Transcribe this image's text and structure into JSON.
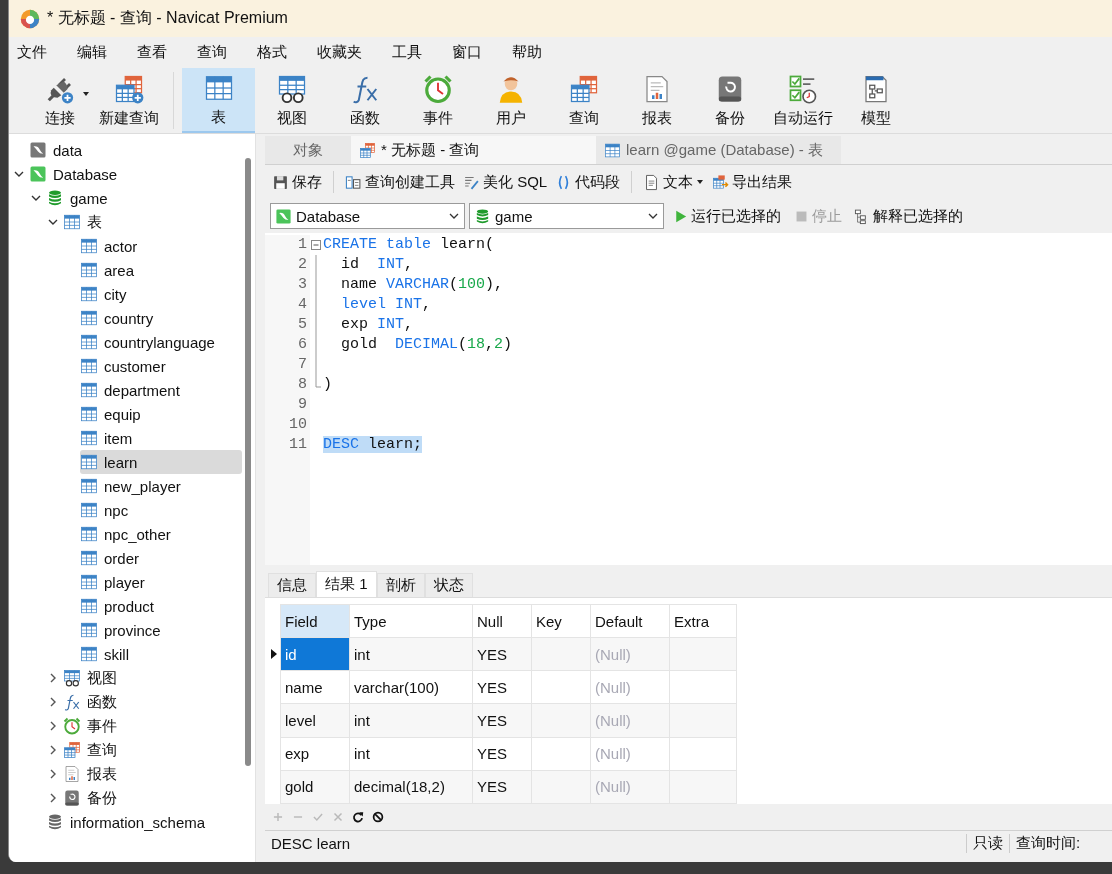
{
  "window": {
    "title": "* 无标题 - 查询 - Navicat Premium"
  },
  "menu": [
    "文件",
    "编辑",
    "查看",
    "查询",
    "格式",
    "收藏夹",
    "工具",
    "窗口",
    "帮助"
  ],
  "toolbar": [
    {
      "label": "连接",
      "selected": false,
      "dropdown": true
    },
    {
      "label": "新建查询",
      "selected": false,
      "dropdown": false
    },
    {
      "label": "表",
      "selected": true,
      "dropdown": false
    },
    {
      "label": "视图",
      "selected": false,
      "dropdown": false
    },
    {
      "label": "函数",
      "selected": false,
      "dropdown": false
    },
    {
      "label": "事件",
      "selected": false,
      "dropdown": false
    },
    {
      "label": "用户",
      "selected": false,
      "dropdown": false
    },
    {
      "label": "查询",
      "selected": false,
      "dropdown": false
    },
    {
      "label": "报表",
      "selected": false,
      "dropdown": false
    },
    {
      "label": "备份",
      "selected": false,
      "dropdown": false
    },
    {
      "label": "自动运行",
      "selected": false,
      "dropdown": false
    },
    {
      "label": "模型",
      "selected": false,
      "dropdown": false
    }
  ],
  "tree": [
    {
      "label": "data",
      "kind": "connection",
      "connected": false,
      "selected": false
    },
    {
      "label": "Database",
      "kind": "connection",
      "connected": true,
      "selected": false,
      "expanded": true,
      "children": [
        {
          "label": "game",
          "kind": "database",
          "connected": true,
          "selected": false,
          "expanded": true,
          "children": [
            {
              "label": "表",
              "kind": "tables",
              "selected": false,
              "expanded": true,
              "children": [
                {
                  "label": "actor",
                  "kind": "table",
                  "selected": false
                },
                {
                  "label": "area",
                  "kind": "table",
                  "selected": false
                },
                {
                  "label": "city",
                  "kind": "table",
                  "selected": false
                },
                {
                  "label": "country",
                  "kind": "table",
                  "selected": false
                },
                {
                  "label": "countrylanguage",
                  "kind": "table",
                  "selected": false
                },
                {
                  "label": "customer",
                  "kind": "table",
                  "selected": false
                },
                {
                  "label": "department",
                  "kind": "table",
                  "selected": false
                },
                {
                  "label": "equip",
                  "kind": "table",
                  "selected": false
                },
                {
                  "label": "item",
                  "kind": "table",
                  "selected": false
                },
                {
                  "label": "learn",
                  "kind": "table",
                  "selected": true
                },
                {
                  "label": "new_player",
                  "kind": "table",
                  "selected": false
                },
                {
                  "label": "npc",
                  "kind": "table",
                  "selected": false
                },
                {
                  "label": "npc_other",
                  "kind": "table",
                  "selected": false
                },
                {
                  "label": "order",
                  "kind": "table",
                  "selected": false
                },
                {
                  "label": "player",
                  "kind": "table",
                  "selected": false
                },
                {
                  "label": "product",
                  "kind": "table",
                  "selected": false
                },
                {
                  "label": "province",
                  "kind": "table",
                  "selected": false
                },
                {
                  "label": "skill",
                  "kind": "table",
                  "selected": false
                }
              ]
            },
            {
              "label": "视图",
              "kind": "views",
              "selected": false,
              "expanded": false
            },
            {
              "label": "函数",
              "kind": "functions",
              "selected": false,
              "expanded": false
            },
            {
              "label": "事件",
              "kind": "events",
              "selected": false,
              "expanded": false
            },
            {
              "label": "查询",
              "kind": "queries",
              "selected": false,
              "expanded": false
            },
            {
              "label": "报表",
              "kind": "reports",
              "selected": false,
              "expanded": false
            },
            {
              "label": "备份",
              "kind": "backups",
              "selected": false,
              "expanded": false
            }
          ]
        },
        {
          "label": "information_schema",
          "kind": "database",
          "connected": false,
          "selected": false
        }
      ]
    }
  ],
  "doc_tabs": [
    {
      "label": "对象",
      "kind": "objects",
      "selected": false
    },
    {
      "label": "* 无标题 - 查询",
      "kind": "query",
      "selected": true
    },
    {
      "label": "learn @game (Database) - 表",
      "kind": "table",
      "selected": false
    }
  ],
  "query_toolbar": [
    {
      "label": "保存",
      "dropdown": false
    },
    {
      "label": "查询创建工具",
      "dropdown": false
    },
    {
      "label": "美化 SQL",
      "dropdown": false
    },
    {
      "label": "代码段",
      "dropdown": false
    },
    {
      "label": "文本",
      "dropdown": true
    },
    {
      "label": "导出结果",
      "dropdown": false
    }
  ],
  "connection_select": {
    "value": "Database"
  },
  "database_select": {
    "value": "game"
  },
  "run_actions": [
    {
      "label": "运行已选择的",
      "disabled": false
    },
    {
      "label": "停止",
      "disabled": true
    },
    {
      "label": "解释已选择的",
      "disabled": false
    }
  ],
  "editor": {
    "lines": [
      {
        "number": "1",
        "fold_start": true,
        "in_fold": false,
        "fold_end": false,
        "selected": false,
        "tokens": [
          {
            "text": "CREATE table ",
            "kind": "keyword"
          },
          {
            "text": "learn(",
            "kind": "plain"
          }
        ]
      },
      {
        "number": "2",
        "fold_start": false,
        "in_fold": true,
        "fold_end": false,
        "selected": false,
        "tokens": [
          {
            "text": "  id  ",
            "kind": "plain"
          },
          {
            "text": "INT",
            "kind": "keyword"
          },
          {
            "text": ",",
            "kind": "plain"
          }
        ]
      },
      {
        "number": "3",
        "fold_start": false,
        "in_fold": true,
        "fold_end": false,
        "selected": false,
        "tokens": [
          {
            "text": "  name ",
            "kind": "plain"
          },
          {
            "text": "VARCHAR",
            "kind": "keyword"
          },
          {
            "text": "(",
            "kind": "plain"
          },
          {
            "text": "100",
            "kind": "number"
          },
          {
            "text": "),",
            "kind": "plain"
          }
        ]
      },
      {
        "number": "4",
        "fold_start": false,
        "in_fold": true,
        "fold_end": false,
        "selected": false,
        "tokens": [
          {
            "text": "  level INT",
            "kind": "keyword"
          },
          {
            "text": ",",
            "kind": "plain"
          }
        ]
      },
      {
        "number": "5",
        "fold_start": false,
        "in_fold": true,
        "fold_end": false,
        "selected": false,
        "tokens": [
          {
            "text": "  exp ",
            "kind": "plain"
          },
          {
            "text": "INT",
            "kind": "keyword"
          },
          {
            "text": ",",
            "kind": "plain"
          }
        ]
      },
      {
        "number": "6",
        "fold_start": false,
        "in_fold": true,
        "fold_end": false,
        "selected": false,
        "tokens": [
          {
            "text": "  gold  ",
            "kind": "plain"
          },
          {
            "text": "DECIMAL",
            "kind": "keyword"
          },
          {
            "text": "(",
            "kind": "plain"
          },
          {
            "text": "18",
            "kind": "number"
          },
          {
            "text": ",",
            "kind": "plain"
          },
          {
            "text": "2",
            "kind": "number"
          },
          {
            "text": ")",
            "kind": "plain"
          }
        ]
      },
      {
        "number": "7",
        "fold_start": false,
        "in_fold": true,
        "fold_end": false,
        "selected": false
      },
      {
        "number": "8",
        "fold_start": false,
        "in_fold": false,
        "fold_end": true,
        "selected": false,
        "tokens": [
          {
            "text": ")",
            "kind": "plain"
          }
        ]
      },
      {
        "number": "9",
        "fold_start": false,
        "in_fold": false,
        "fold_end": false,
        "selected": false
      },
      {
        "number": "10",
        "fold_start": false,
        "in_fold": false,
        "fold_end": false,
        "selected": false
      },
      {
        "number": "11",
        "fold_start": false,
        "in_fold": false,
        "fold_end": false,
        "selected": true,
        "tokens": [
          {
            "text": "DESC ",
            "kind": "keyword"
          },
          {
            "text": "learn;",
            "kind": "plain"
          }
        ]
      }
    ]
  },
  "result_tabs": [
    {
      "label": "信息",
      "selected": false
    },
    {
      "label": "结果 1",
      "selected": true
    },
    {
      "label": "剖析",
      "selected": false
    },
    {
      "label": "状态",
      "selected": false
    }
  ],
  "grid": {
    "columns": [
      {
        "label": "Field",
        "selected": true
      },
      {
        "label": "Type",
        "selected": false
      },
      {
        "label": "Null",
        "selected": false
      },
      {
        "label": "Key",
        "selected": false
      },
      {
        "label": "Default",
        "selected": false
      },
      {
        "label": "Extra",
        "selected": false
      }
    ],
    "rows": [
      {
        "current": true,
        "default_is_null": true,
        "cells": [
          "id",
          "int",
          "YES",
          null,
          "(Null)",
          null
        ]
      },
      {
        "current": false,
        "default_is_null": true,
        "cells": [
          "name",
          "varchar(100)",
          "YES",
          null,
          "(Null)",
          null
        ]
      },
      {
        "current": false,
        "default_is_null": true,
        "cells": [
          "level",
          "int",
          "YES",
          null,
          "(Null)",
          null
        ]
      },
      {
        "current": false,
        "default_is_null": true,
        "cells": [
          "exp",
          "int",
          "YES",
          null,
          "(Null)",
          null
        ]
      },
      {
        "current": false,
        "default_is_null": true,
        "cells": [
          "gold",
          "decimal(18,2)",
          "YES",
          null,
          "(Null)",
          null
        ]
      }
    ]
  },
  "grid_tools": [
    {
      "disabled": true
    },
    {
      "disabled": true
    },
    {
      "disabled": true
    },
    {
      "disabled": true
    },
    {
      "disabled": false
    },
    {
      "disabled": false
    }
  ],
  "status_bar": {
    "query": "DESC learn",
    "mode": "只读",
    "time_label": "查询时间:"
  }
}
